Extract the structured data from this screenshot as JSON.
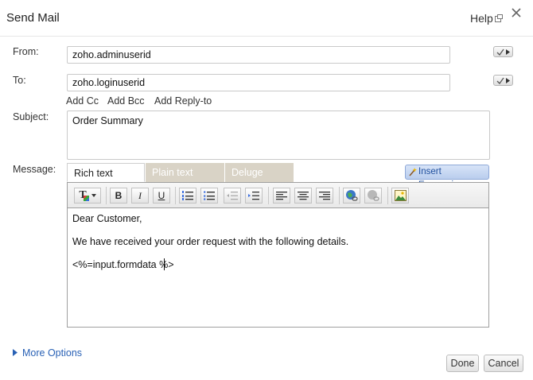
{
  "dialog": {
    "title": "Send Mail",
    "help_label": "Help"
  },
  "form": {
    "from_label": "From:",
    "from_value": "zoho.adminuserid",
    "to_label": "To:",
    "to_value": "zoho.loginuserid",
    "add_cc": "Add Cc",
    "add_bcc": "Add Bcc",
    "add_reply_to": "Add Reply-to",
    "subject_label": "Subject:",
    "subject_value": "Order Summary",
    "message_label": "Message:"
  },
  "tabs": [
    {
      "label": "Rich text mode",
      "active": true
    },
    {
      "label": "Plain text mode",
      "active": false
    },
    {
      "label": "Deluge Mode",
      "active": false
    }
  ],
  "insert_expression_label": "Insert Expression",
  "toolbar": {
    "font_glyph": "T",
    "bold": "B",
    "italic": "I",
    "underline": "U"
  },
  "message_body": {
    "line1": "Dear Customer,",
    "line2": "We have received your order request with the following details.",
    "line3": "<%=input.formdata %>"
  },
  "footer": {
    "more_options": "More Options",
    "done": "Done",
    "cancel": "Cancel"
  },
  "colors": {
    "link": "#2961b5",
    "inactive_tab": "#d9d3c6",
    "insert_expression_bg": "#c6d6f1"
  }
}
